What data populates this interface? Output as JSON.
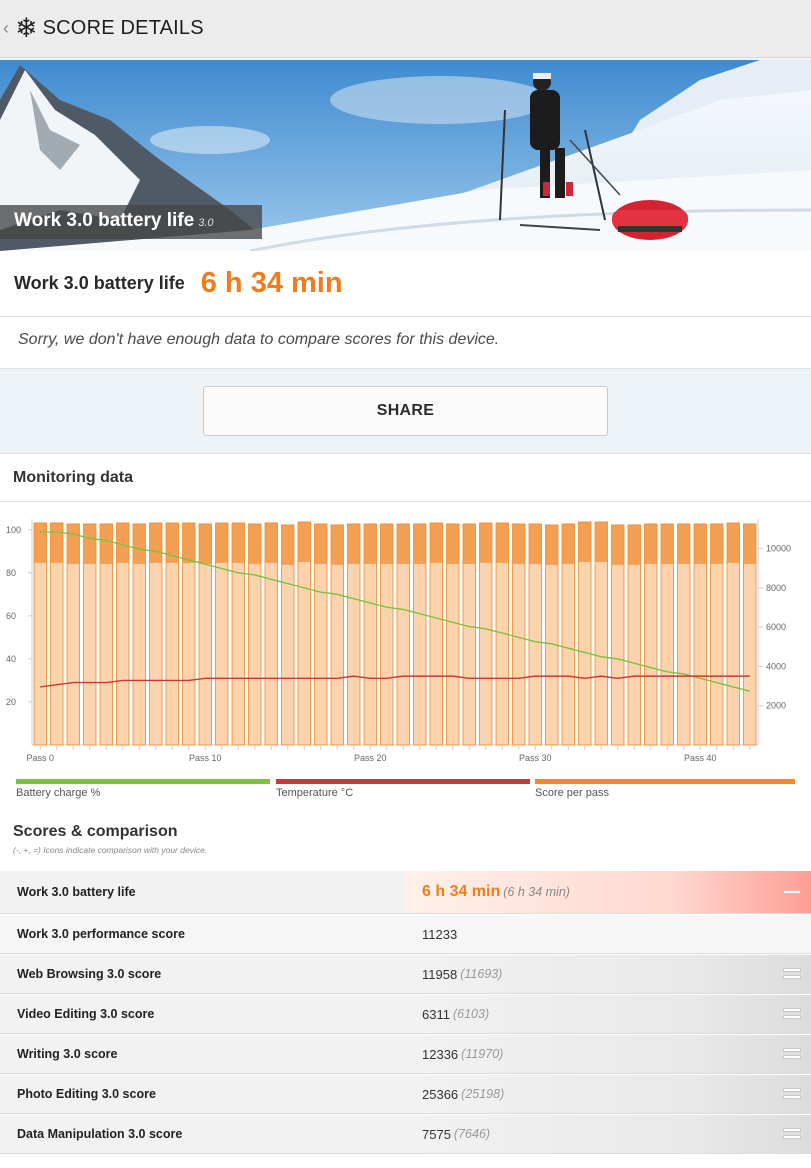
{
  "topbar": {
    "back_glyph": "‹",
    "logo_icon": "snowflake-icon",
    "logo_glyph": "❄",
    "title": "SCORE DETAILS"
  },
  "hero": {
    "title": "Work 3.0 battery life",
    "version": "3.0"
  },
  "result": {
    "label": "Work 3.0 battery life",
    "value": "6 h 34 min",
    "note": "Sorry, we don't have enough data to compare scores for this device."
  },
  "share": {
    "label": "SHARE"
  },
  "monitoring": {
    "title": "Monitoring data",
    "legend": [
      {
        "label": "Battery charge %",
        "color": "#7cc142"
      },
      {
        "label": "Temperature °C",
        "color": "#c9373a"
      },
      {
        "label": "Score per pass",
        "color": "#ef8a2b"
      }
    ]
  },
  "chart_data": {
    "type": "bar",
    "title": "",
    "x_tick_labels": [
      "Pass 0",
      "Pass 10",
      "Pass 20",
      "Pass 30",
      "Pass 40"
    ],
    "left_axis": {
      "ticks": [
        20,
        40,
        60,
        80,
        100
      ],
      "ylim": [
        0,
        105
      ]
    },
    "right_axis": {
      "ticks": [
        2000,
        4000,
        6000,
        8000,
        10000
      ],
      "ylim": [
        0,
        11500
      ]
    },
    "passes": 44,
    "series": [
      {
        "name": "Score per pass",
        "axis": "right",
        "color": "#ef8a2b",
        "values": [
          11300,
          11300,
          11250,
          11250,
          11250,
          11300,
          11250,
          11300,
          11300,
          11300,
          11250,
          11300,
          11300,
          11250,
          11300,
          11200,
          11350,
          11250,
          11200,
          11250,
          11250,
          11250,
          11250,
          11250,
          11300,
          11250,
          11250,
          11300,
          11300,
          11250,
          11250,
          11200,
          11250,
          11350,
          11350,
          11200,
          11200,
          11250,
          11250,
          11250,
          11250,
          11250,
          11300,
          11250
        ]
      },
      {
        "name": "Battery charge %",
        "axis": "left",
        "color": "#7cc142",
        "values": [
          99,
          99,
          98,
          96,
          95,
          93,
          91,
          90,
          88,
          86,
          84,
          82,
          80,
          79,
          77,
          75,
          73,
          71,
          70,
          68,
          66,
          64,
          63,
          61,
          59,
          57,
          55,
          54,
          52,
          50,
          48,
          47,
          45,
          43,
          41,
          40,
          38,
          36,
          34,
          33,
          31,
          29,
          27,
          25
        ]
      },
      {
        "name": "Temperature °C",
        "axis": "left",
        "color": "#c9373a",
        "values": [
          27,
          28,
          29,
          29,
          29,
          30,
          30,
          30,
          30,
          30,
          31,
          31,
          31,
          31,
          31,
          31,
          31,
          31,
          31,
          32,
          31,
          31,
          32,
          32,
          32,
          32,
          31,
          31,
          31,
          31,
          32,
          32,
          32,
          31,
          32,
          31,
          32,
          32,
          32,
          32,
          32,
          32,
          32,
          32
        ]
      }
    ],
    "grid": false,
    "legend": "bottom"
  },
  "scores": {
    "title": "Scores & comparison",
    "note": "(-, +, =) Icons indicate comparison with your device.",
    "rows": [
      {
        "name": "Work 3.0 battery life",
        "value": "6 h 34 min",
        "ref": "(6 h 34 min)",
        "icon": "minus-icon"
      },
      {
        "name": "Work 3.0 performance score",
        "value": "11233",
        "ref": "",
        "icon": ""
      },
      {
        "name": "Web Browsing 3.0 score",
        "value": "11958",
        "ref": "(11693)",
        "icon": "equals-icon"
      },
      {
        "name": "Video Editing 3.0 score",
        "value": "6311",
        "ref": "(6103)",
        "icon": "equals-icon"
      },
      {
        "name": "Writing 3.0 score",
        "value": "12336",
        "ref": "(11970)",
        "icon": "equals-icon"
      },
      {
        "name": "Photo Editing 3.0 score",
        "value": "25366",
        "ref": "(25198)",
        "icon": "equals-icon"
      },
      {
        "name": "Data Manipulation 3.0 score",
        "value": "7575",
        "ref": "(7646)",
        "icon": "equals-icon"
      }
    ]
  }
}
